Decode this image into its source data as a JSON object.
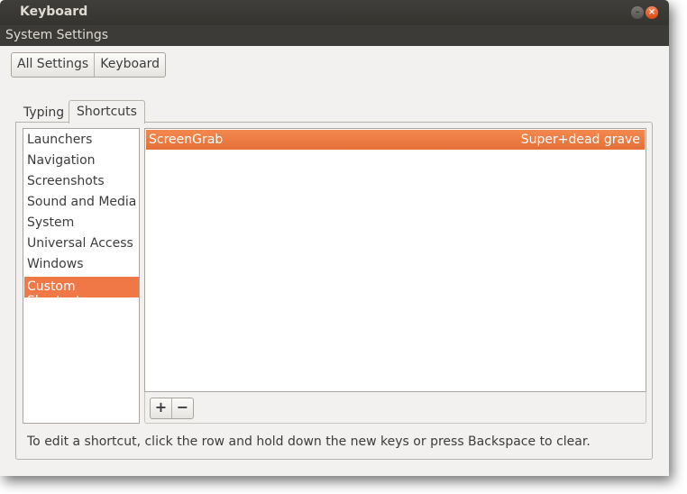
{
  "window": {
    "title": "Keyboard",
    "minimize_glyph": "–",
    "close_glyph": "×"
  },
  "menubar": {
    "label": "System Settings"
  },
  "breadcrumb": [
    "All Settings",
    "Keyboard"
  ],
  "tabs": [
    "Typing",
    "Shortcuts"
  ],
  "active_tab": "Shortcuts",
  "categories": [
    "Launchers",
    "Navigation",
    "Screenshots",
    "Sound and Media",
    "System",
    "Universal Access",
    "Windows",
    "Custom Shortcuts"
  ],
  "selected_category": "Custom Shortcuts",
  "shortcuts": [
    {
      "name": "ScreenGrab",
      "keys": "Super+dead grave"
    }
  ],
  "toolbar": {
    "add_label": "+",
    "remove_label": "−"
  },
  "hint": "To edit a shortcut, click the row and hold down the new keys or press Backspace to clear.",
  "colors": {
    "accent": "#f07746",
    "titlebar": "#3c3b37"
  }
}
